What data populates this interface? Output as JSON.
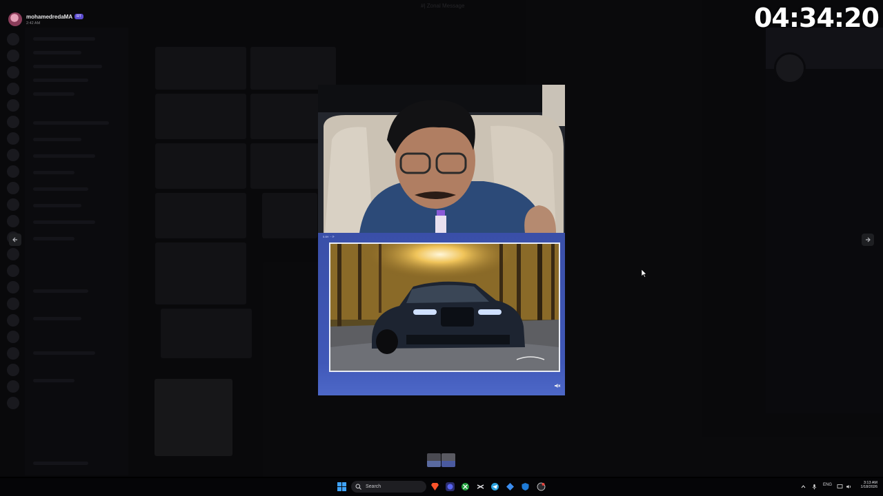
{
  "viewer": {
    "user": {
      "name": "mohamedredaMA",
      "badge": "RT",
      "time": "2:42 AM"
    },
    "stream_timer": "04:34:20",
    "window_title": "#| Zonal Message",
    "nav": {
      "previous_icon": "arrow-left-icon",
      "next_icon": "arrow-right-icon"
    },
    "media": {
      "card_meta": "5.8H ·· ⟳",
      "mute_icon": "speaker-muted-icon"
    },
    "thumbnails_count": 2
  },
  "taskbar": {
    "search_placeholder": "Search",
    "apps": [
      "windows-start-icon",
      "brave-icon",
      "discord-icon",
      "xbox-icon",
      "capcut-icon",
      "telegram-icon",
      "gem-icon",
      "shield-icon",
      "obs-icon"
    ],
    "tray": {
      "language": "ENG",
      "time": "3:13 AM",
      "date": "1/18/2026"
    }
  },
  "colors": {
    "card_blue": "#4058b8",
    "timer_text": "#ffffff",
    "background": "#000000"
  }
}
